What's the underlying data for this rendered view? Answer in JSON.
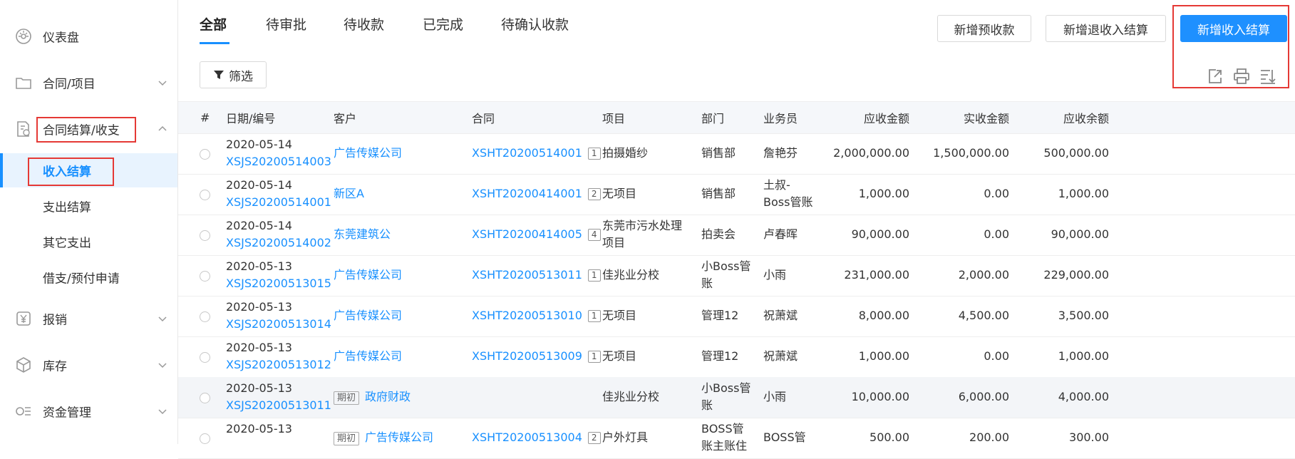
{
  "sidebar": {
    "dashboard": "仪表盘",
    "contract_project": "合同/项目",
    "settlement": "合同结算/收支",
    "sub_items": [
      "收入结算",
      "支出结算",
      "其它支出",
      "借支/预付申请"
    ],
    "reimburse": "报销",
    "inventory": "库存",
    "funds": "资金管理"
  },
  "tabs": [
    "全部",
    "待审批",
    "待收款",
    "已完成",
    "待确认收款"
  ],
  "buttons": {
    "new_prepay": "新增预收款",
    "new_refund": "新增退收入结算",
    "new_income": "新增收入结算",
    "filter": "筛选"
  },
  "table": {
    "headers": [
      "#",
      "日期/编号",
      "客户",
      "合同",
      "项目",
      "部门",
      "业务员",
      "应收金额",
      "实收金额",
      "应收余额"
    ],
    "rows": [
      {
        "date": "2020-05-14",
        "no": "XSJS20200514003",
        "tag": "",
        "customer": "广告传媒公司",
        "contract": "XSHT20200514001",
        "count": "1",
        "project": "拍摄婚纱",
        "dept": "销售部",
        "sales": "詹艳芬",
        "receivable": "2,000,000.00",
        "received": "1,500,000.00",
        "balance": "500,000.00"
      },
      {
        "date": "2020-05-14",
        "no": "XSJS20200514001",
        "tag": "",
        "customer": "新区A",
        "contract": "XSHT20200414001",
        "count": "2",
        "project": "无项目",
        "dept": "销售部",
        "sales": "土叔-Boss管账",
        "receivable": "1,000.00",
        "received": "0.00",
        "balance": "1,000.00"
      },
      {
        "date": "2020-05-14",
        "no": "XSJS20200514002",
        "tag": "",
        "customer": "东莞建筑公",
        "contract": "XSHT20200414005",
        "count": "4",
        "project": "东莞市污水处理项目",
        "dept": "拍卖会",
        "sales": "卢春晖",
        "receivable": "90,000.00",
        "received": "0.00",
        "balance": "90,000.00"
      },
      {
        "date": "2020-05-13",
        "no": "XSJS20200513015",
        "tag": "",
        "customer": "广告传媒公司",
        "contract": "XSHT20200513011",
        "count": "1",
        "project": "佳兆业分校",
        "dept": "小Boss管账",
        "sales": "小雨",
        "receivable": "231,000.00",
        "received": "2,000.00",
        "balance": "229,000.00"
      },
      {
        "date": "2020-05-13",
        "no": "XSJS20200513014",
        "tag": "",
        "customer": "广告传媒公司",
        "contract": "XSHT20200513010",
        "count": "1",
        "project": "无项目",
        "dept": "管理12",
        "sales": "祝萧斌",
        "receivable": "8,000.00",
        "received": "4,500.00",
        "balance": "3,500.00"
      },
      {
        "date": "2020-05-13",
        "no": "XSJS20200513012",
        "tag": "",
        "customer": "广告传媒公司",
        "contract": "XSHT20200513009",
        "count": "1",
        "project": "无项目",
        "dept": "管理12",
        "sales": "祝萧斌",
        "receivable": "1,000.00",
        "received": "0.00",
        "balance": "1,000.00"
      },
      {
        "date": "2020-05-13",
        "no": "XSJS20200513011",
        "tag": "期初",
        "customer": "政府财政",
        "contract": "",
        "count": "",
        "project": "佳兆业分校",
        "dept": "小Boss管账",
        "sales": "小雨",
        "receivable": "10,000.00",
        "received": "6,000.00",
        "balance": "4,000.00"
      },
      {
        "date": "2020-05-13",
        "no": "",
        "tag": "期初",
        "customer": "广告传媒公司",
        "contract": "XSHT20200513004",
        "count": "2",
        "project": "户外灯具",
        "dept": "BOSS管账主账住",
        "sales": "BOSS管",
        "receivable": "500.00",
        "received": "200.00",
        "balance": "300.00"
      }
    ]
  },
  "colors": {
    "primary": "#1890ff",
    "highlight_box": "#e53935"
  }
}
